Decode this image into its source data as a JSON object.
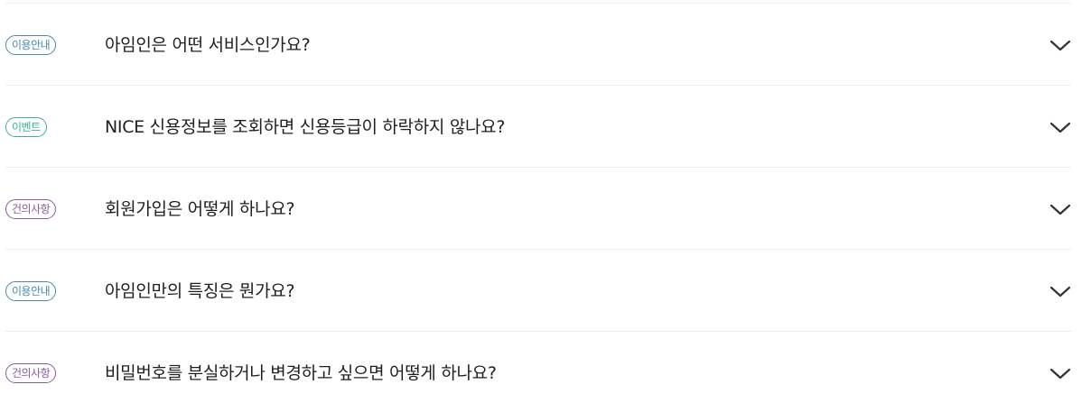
{
  "faq": [
    {
      "category": "이용안내",
      "category_color": "#4a8aa7",
      "question": "아임인은 어떤 서비스인가요?",
      "icon": "chevron-down-icon"
    },
    {
      "category": "이벤트",
      "category_color": "#3fae9d",
      "question": "NICE 신용정보를 조회하면 신용등급이 하락하지 않나요?",
      "icon": "chevron-down-icon"
    },
    {
      "category": "건의사항",
      "category_color": "#8a5aa0",
      "question": "회원가입은 어떻게 하나요?",
      "icon": "chevron-down-icon"
    },
    {
      "category": "이용안내",
      "category_color": "#4a8aa7",
      "question": "아임인만의 특징은 뭔가요?",
      "icon": "chevron-down-icon"
    },
    {
      "category": "건의사항",
      "category_color": "#8a5aa0",
      "question": "비밀번호를 분실하거나 변경하고 싶으면 어떻게 하나요?",
      "icon": "chevron-down-icon"
    }
  ]
}
